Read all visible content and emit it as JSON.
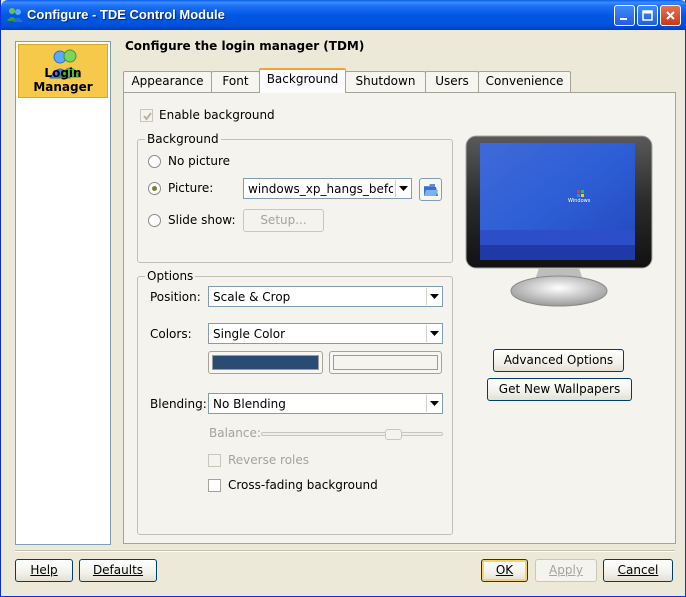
{
  "window": {
    "title": "Configure - TDE Control Module"
  },
  "sidebar": {
    "items": [
      {
        "label": "Login Manager"
      }
    ]
  },
  "heading": "Configure the login manager (TDM)",
  "tabs": [
    {
      "label": "Appearance"
    },
    {
      "label": "Font"
    },
    {
      "label": "Background",
      "active": true
    },
    {
      "label": "Shutdown"
    },
    {
      "label": "Users"
    },
    {
      "label": "Convenience"
    }
  ],
  "background_tab": {
    "enable_background": {
      "label": "Enable background",
      "checked": true
    },
    "background_group": {
      "title": "Background",
      "no_picture": "No picture",
      "picture": "Picture:",
      "picture_value": "windows_xp_hangs_before_",
      "slide_show": "Slide show:",
      "setup_button": "Setup..."
    },
    "options_group": {
      "title": "Options",
      "position_label": "Position:",
      "position_value": "Scale & Crop",
      "colors_label": "Colors:",
      "colors_value": "Single Color",
      "color1": "#2a4b73",
      "color2": "#f5f4ef",
      "blending_label": "Blending:",
      "blending_value": "No Blending",
      "balance_label": "Balance:",
      "reverse_roles": "Reverse roles",
      "cross_fading": "Cross-fading background"
    },
    "preview": {
      "wallpaper_logo": "Windows"
    },
    "advanced_options_button": "Advanced Options",
    "get_new_wallpapers_button": "Get New Wallpapers"
  },
  "footer": {
    "help": "Help",
    "defaults": "Defaults",
    "ok": "OK",
    "apply": "Apply",
    "cancel": "Cancel"
  }
}
